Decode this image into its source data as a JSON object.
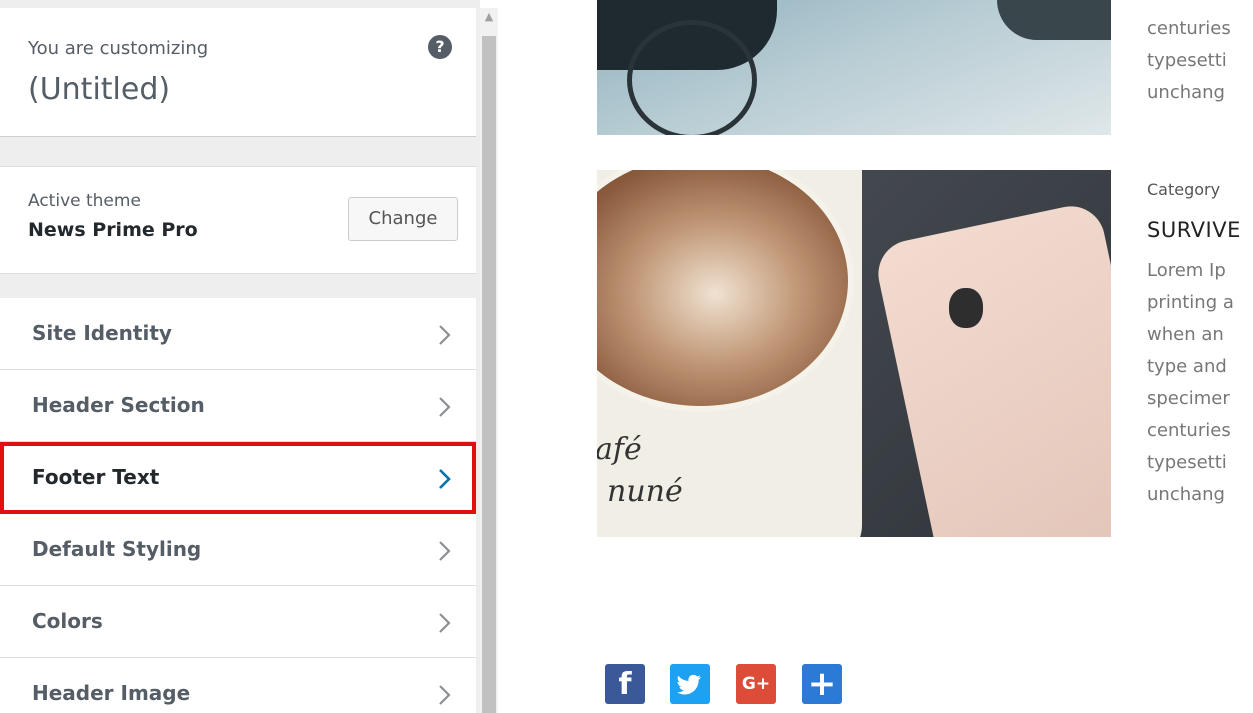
{
  "sidebar": {
    "customizing_label": "You are customizing",
    "site_title": "(Untitled)",
    "help_icon": "question-circle-icon",
    "active_theme_label": "Active theme",
    "theme_name": "News Prime Pro",
    "change_label": "Change",
    "items": [
      {
        "label": "Site Identity"
      },
      {
        "label": "Header Section"
      },
      {
        "label": "Footer Text",
        "highlighted": true
      },
      {
        "label": "Default Styling"
      },
      {
        "label": "Colors"
      },
      {
        "label": "Header Image"
      }
    ]
  },
  "preview": {
    "top_text_lines": [
      "centuries",
      "typesetti",
      "unchang"
    ],
    "post": {
      "category": "Category",
      "title": "SURVIVE",
      "lines": [
        "Lorem Ip",
        "printing a",
        "when an",
        "type and",
        "specimer",
        "centuries",
        "typesetti",
        "unchang"
      ]
    },
    "cup_text": [
      "afé",
      "nuné"
    ],
    "social": [
      {
        "icon": "facebook-icon",
        "glyph": "f",
        "color": "#3b5998"
      },
      {
        "icon": "twitter-icon",
        "glyph": "",
        "color": "#1da1f2"
      },
      {
        "icon": "google-plus-icon",
        "glyph": "G+",
        "color": "#dd4b39"
      },
      {
        "icon": "share-plus-icon",
        "glyph": "+",
        "color": "#2b7bd6"
      }
    ]
  },
  "colors": {
    "highlight": "#dd1111",
    "chevron_active": "#0073aa"
  }
}
